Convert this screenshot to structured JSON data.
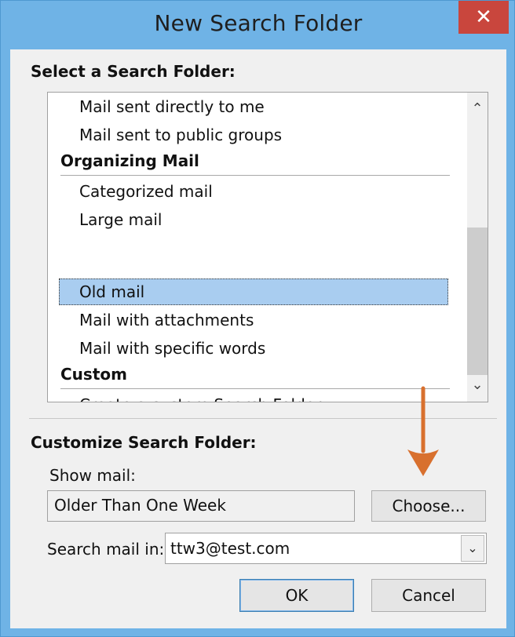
{
  "window": {
    "title": "New Search Folder",
    "close_glyph": "✕"
  },
  "select_section": {
    "label": "Select a Search Folder:"
  },
  "list": {
    "rows": [
      {
        "type": "item",
        "text": "Mail sent directly to me"
      },
      {
        "type": "item",
        "text": "Mail sent to public groups"
      },
      {
        "type": "header",
        "text": "Organizing Mail"
      },
      {
        "type": "item",
        "text": "Categorized mail"
      },
      {
        "type": "item",
        "text": "Large mail"
      },
      {
        "type": "item",
        "text": "Old mail",
        "selected": true
      },
      {
        "type": "item",
        "text": "Mail with attachments"
      },
      {
        "type": "item",
        "text": "Mail with specific words"
      },
      {
        "type": "header",
        "text": "Custom"
      },
      {
        "type": "item",
        "text": "Create a custom Search Folder"
      }
    ],
    "scroll_up_glyph": "⌃",
    "scroll_down_glyph": "⌄"
  },
  "customize_section": {
    "label": "Customize Search Folder:",
    "show_mail_label": "Show mail:",
    "show_mail_value": "Older Than One Week",
    "choose_button": "Choose...",
    "search_in_label": "Search mail in:",
    "search_in_value": "ttw3@test.com",
    "dropdown_glyph": "⌄"
  },
  "buttons": {
    "ok": "OK",
    "cancel": "Cancel"
  },
  "colors": {
    "titlebar": "#6fb3e6",
    "close": "#c9463d",
    "selection": "#a9cdf0",
    "annotation_arrow": "#d8702e"
  }
}
